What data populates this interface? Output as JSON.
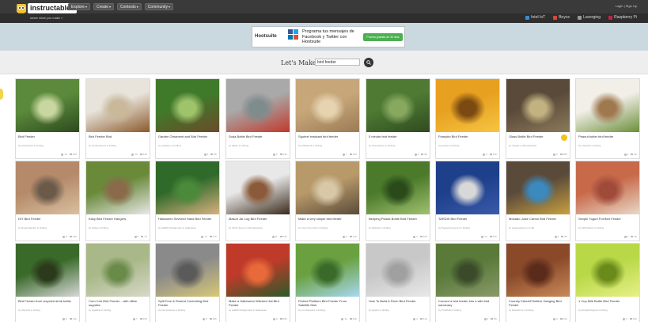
{
  "header": {
    "logo_text": "instructables",
    "tagline": "share what you make >",
    "nav": [
      "Explore",
      "Create",
      "Contests",
      "Community"
    ],
    "auth": "Login | Sign Up",
    "channels": [
      "Intel IoT",
      "Boyce",
      "Laverging",
      "Raspberry Pi"
    ]
  },
  "ad": {
    "brand": "Hootsuite",
    "text": "Programa tus mensajes de Facebook y Twitter con Hootsuite",
    "button": "Prueba gratuita de 30 días"
  },
  "search": {
    "label": "Let's Make",
    "value": "bird feeder"
  },
  "cards": [
    {
      "title": "Bird Feeder",
      "author": "by pianoboard in birding",
      "favs": "10",
      "views": "32K",
      "colors": [
        "#5b8a3c",
        "#2d4a1e",
        "#c8d6a0"
      ]
    },
    {
      "title": "Bird Feeder Bird",
      "author": "by woodenbarns in birding",
      "favs": "12",
      "views": "14K",
      "colors": [
        "#e8e4dc",
        "#8b5a2b",
        "#c9b89a"
      ]
    },
    {
      "title": "Garden Ornament and Bird Feeder",
      "author": "by Ladyfury in birding",
      "favs": "3",
      "views": "8K",
      "colors": [
        "#3f7a2a",
        "#6b4a2b",
        "#9ec36b"
      ]
    },
    {
      "title": "Soda Bottle Bird Feeder",
      "author": "by fatbjm in birding",
      "favs": "5",
      "views": "21K",
      "colors": [
        "#a9a9a9",
        "#c0392b",
        "#7f8c8d"
      ]
    },
    {
      "title": "Squirrel resistant bird feeder",
      "author": "by wallstoreli in birding",
      "favs": "7",
      "views": "13K",
      "colors": [
        "#c7a77a",
        "#9c7b55",
        "#e6d3b0"
      ]
    },
    {
      "title": "5 minute bird feeder",
      "author": "by Thecrapture in birding",
      "favs": "4",
      "views": "9K",
      "colors": [
        "#4e7a33",
        "#2f4a20",
        "#88a860"
      ]
    },
    {
      "title": "Pumpkin Bird Feeder",
      "author": "by jeinjeel in birding",
      "favs": "6",
      "views": "11K",
      "colors": [
        "#e8a020",
        "#f5c542",
        "#7a4a12"
      ]
    },
    {
      "title": "Glass Bottle Bird Feeder",
      "author": "by mlpapi in Woodworking",
      "favs": "9",
      "views": "28K",
      "colors": [
        "#5a4a3a",
        "#8a7a5a",
        "#c2b280"
      ]
    },
    {
      "title": "Peanut butter bird feeder",
      "author": "by mastsoft in birding",
      "favs": "2",
      "views": "6K",
      "colors": [
        "#f2efe8",
        "#6b8e3a",
        "#a07850"
      ]
    },
    {
      "title": "DIY Bird Feeder",
      "author": "by Deeperbanker in birding",
      "favs": "8",
      "views": "19K",
      "colors": [
        "#b58a6a",
        "#d8c0a0",
        "#6b5a4a"
      ]
    },
    {
      "title": "Easy Bird Feeder Hangers",
      "author": "by Tellsa in birding",
      "favs": "3",
      "views": "7K",
      "colors": [
        "#6a8a3a",
        "#e8e8e8",
        "#8a6a4a"
      ]
    },
    {
      "title": "Halloween Severed Hand Bird Feeder",
      "author": "by wild60 Outdgmoder in Halloween",
      "favs": "14",
      "views": "17K",
      "colors": [
        "#2f6a2a",
        "#d8b080",
        "#4a8a3a"
      ]
    },
    {
      "title": "Mason Jar Log Bird Feeder",
      "author": "by Scrittr Snuru in Woodworking",
      "favs": "11",
      "views": "24K",
      "colors": [
        "#e8e8e8",
        "#3a2a1a",
        "#8a5a3a"
      ]
    },
    {
      "title": "Make a very simple bird feeder",
      "author": "by Cat in the Sock in birding",
      "favs": "5",
      "views": "12K",
      "colors": [
        "#b89a6a",
        "#5a4a3a",
        "#d8c8a8"
      ]
    },
    {
      "title": "Beeping Plastic Bottle Bird Feeder",
      "author": "by Sjulinde in birding",
      "favs": "4",
      "views": "10K",
      "colors": [
        "#4a7a2a",
        "#a0c070",
        "#2a4a1a"
      ]
    },
    {
      "title": "TARDIS Bird Feeder",
      "author": "by Papperbuscomer in birding",
      "favs": "22",
      "views": "31K",
      "colors": [
        "#1e3f8a",
        "#3a5aaa",
        "#d8d8d8"
      ]
    },
    {
      "title": "Mobado Juice Carton Bird Feeder",
      "author": "by waterwatsers in Craft",
      "favs": "6",
      "views": "9K",
      "colors": [
        "#5a4a3a",
        "#c8a040",
        "#3a8ac0"
      ]
    },
    {
      "title": "Simple Yogurt Pot Bird Feeder",
      "author": "by Tall Pachos in birding",
      "favs": "3",
      "views": "5K",
      "colors": [
        "#c86a4a",
        "#e8d8c8",
        "#a04a3a"
      ]
    },
    {
      "title": "Bird Feeder from recycled drink bottle",
      "author": "by Wen22s in birding",
      "favs": "5",
      "views": "14K",
      "colors": [
        "#3a6a2a",
        "#d8d8d8",
        "#2a3a1a"
      ]
    },
    {
      "title": "Corn Cob Bird Feeder... with office supplies",
      "author": "by wgabbai in birding",
      "favs": "7",
      "views": "16K",
      "colors": [
        "#a8b888",
        "#d8d8c8",
        "#6a8a4a"
      ]
    },
    {
      "title": "Split Free & Rodent Controlling Bird Feeder",
      "author": "by Kar Andrews in birding",
      "favs": "8",
      "views": "18K",
      "colors": [
        "#8a8a8a",
        "#d8c878",
        "#5a5a5a"
      ]
    },
    {
      "title": "Make a Halloween Witches Hat Bird Feeder",
      "author": "by wild60 Outdgmoder in Halloween",
      "favs": "9",
      "views": "15K",
      "colors": [
        "#c03a2a",
        "#2a5a2a",
        "#e86a3a"
      ]
    },
    {
      "title": "Perfect Platform Bird Feeder From Satellite Dish",
      "author": "by ComGeniacs in birding",
      "favs": "10",
      "views": "20K",
      "colors": [
        "#6aa040",
        "#a8d8f0",
        "#3a6a2a"
      ]
    },
    {
      "title": "How To Build A Finch Bird Feeder",
      "author": "by lapprix in birding",
      "favs": "4",
      "views": "11K",
      "colors": [
        "#c8c8c8",
        "#e8e8e8",
        "#a0a0a0"
      ]
    },
    {
      "title": "Convert a bird feeder into a wild bird sanctuary",
      "author": "by ProMMS in birding",
      "favs": "3",
      "views": "8K",
      "colors": [
        "#5a7a3a",
        "#8a9a6a",
        "#3a4a2a"
      ]
    },
    {
      "title": "Country Kitsch/Primitive Hanging Bird Feeder",
      "author": "by RaCharms in birding",
      "favs": "6",
      "views": "12K",
      "colors": [
        "#8a4a2a",
        "#c88a5a",
        "#5a2a1a"
      ]
    },
    {
      "title": "1 Cup Milk Bottle Bird Feeder",
      "author": "by Donaldt Sigma in birding",
      "favs": "5",
      "views": "10K",
      "colors": [
        "#b8d848",
        "#e8f088",
        "#6a8a1a"
      ]
    }
  ]
}
